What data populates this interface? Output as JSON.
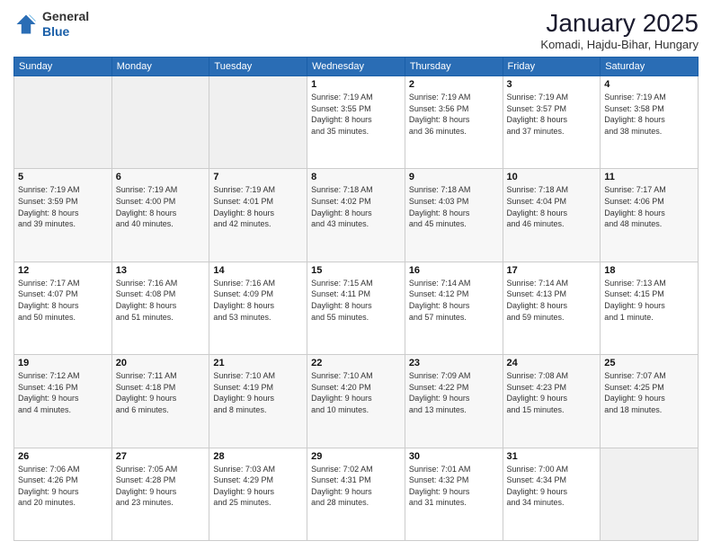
{
  "header": {
    "logo": {
      "general": "General",
      "blue": "Blue"
    },
    "title": "January 2025",
    "location": "Komadi, Hajdu-Bihar, Hungary"
  },
  "weekdays": [
    "Sunday",
    "Monday",
    "Tuesday",
    "Wednesday",
    "Thursday",
    "Friday",
    "Saturday"
  ],
  "weeks": [
    [
      {
        "day": "",
        "info": ""
      },
      {
        "day": "",
        "info": ""
      },
      {
        "day": "",
        "info": ""
      },
      {
        "day": "1",
        "info": "Sunrise: 7:19 AM\nSunset: 3:55 PM\nDaylight: 8 hours\nand 35 minutes."
      },
      {
        "day": "2",
        "info": "Sunrise: 7:19 AM\nSunset: 3:56 PM\nDaylight: 8 hours\nand 36 minutes."
      },
      {
        "day": "3",
        "info": "Sunrise: 7:19 AM\nSunset: 3:57 PM\nDaylight: 8 hours\nand 37 minutes."
      },
      {
        "day": "4",
        "info": "Sunrise: 7:19 AM\nSunset: 3:58 PM\nDaylight: 8 hours\nand 38 minutes."
      }
    ],
    [
      {
        "day": "5",
        "info": "Sunrise: 7:19 AM\nSunset: 3:59 PM\nDaylight: 8 hours\nand 39 minutes."
      },
      {
        "day": "6",
        "info": "Sunrise: 7:19 AM\nSunset: 4:00 PM\nDaylight: 8 hours\nand 40 minutes."
      },
      {
        "day": "7",
        "info": "Sunrise: 7:19 AM\nSunset: 4:01 PM\nDaylight: 8 hours\nand 42 minutes."
      },
      {
        "day": "8",
        "info": "Sunrise: 7:18 AM\nSunset: 4:02 PM\nDaylight: 8 hours\nand 43 minutes."
      },
      {
        "day": "9",
        "info": "Sunrise: 7:18 AM\nSunset: 4:03 PM\nDaylight: 8 hours\nand 45 minutes."
      },
      {
        "day": "10",
        "info": "Sunrise: 7:18 AM\nSunset: 4:04 PM\nDaylight: 8 hours\nand 46 minutes."
      },
      {
        "day": "11",
        "info": "Sunrise: 7:17 AM\nSunset: 4:06 PM\nDaylight: 8 hours\nand 48 minutes."
      }
    ],
    [
      {
        "day": "12",
        "info": "Sunrise: 7:17 AM\nSunset: 4:07 PM\nDaylight: 8 hours\nand 50 minutes."
      },
      {
        "day": "13",
        "info": "Sunrise: 7:16 AM\nSunset: 4:08 PM\nDaylight: 8 hours\nand 51 minutes."
      },
      {
        "day": "14",
        "info": "Sunrise: 7:16 AM\nSunset: 4:09 PM\nDaylight: 8 hours\nand 53 minutes."
      },
      {
        "day": "15",
        "info": "Sunrise: 7:15 AM\nSunset: 4:11 PM\nDaylight: 8 hours\nand 55 minutes."
      },
      {
        "day": "16",
        "info": "Sunrise: 7:14 AM\nSunset: 4:12 PM\nDaylight: 8 hours\nand 57 minutes."
      },
      {
        "day": "17",
        "info": "Sunrise: 7:14 AM\nSunset: 4:13 PM\nDaylight: 8 hours\nand 59 minutes."
      },
      {
        "day": "18",
        "info": "Sunrise: 7:13 AM\nSunset: 4:15 PM\nDaylight: 9 hours\nand 1 minute."
      }
    ],
    [
      {
        "day": "19",
        "info": "Sunrise: 7:12 AM\nSunset: 4:16 PM\nDaylight: 9 hours\nand 4 minutes."
      },
      {
        "day": "20",
        "info": "Sunrise: 7:11 AM\nSunset: 4:18 PM\nDaylight: 9 hours\nand 6 minutes."
      },
      {
        "day": "21",
        "info": "Sunrise: 7:10 AM\nSunset: 4:19 PM\nDaylight: 9 hours\nand 8 minutes."
      },
      {
        "day": "22",
        "info": "Sunrise: 7:10 AM\nSunset: 4:20 PM\nDaylight: 9 hours\nand 10 minutes."
      },
      {
        "day": "23",
        "info": "Sunrise: 7:09 AM\nSunset: 4:22 PM\nDaylight: 9 hours\nand 13 minutes."
      },
      {
        "day": "24",
        "info": "Sunrise: 7:08 AM\nSunset: 4:23 PM\nDaylight: 9 hours\nand 15 minutes."
      },
      {
        "day": "25",
        "info": "Sunrise: 7:07 AM\nSunset: 4:25 PM\nDaylight: 9 hours\nand 18 minutes."
      }
    ],
    [
      {
        "day": "26",
        "info": "Sunrise: 7:06 AM\nSunset: 4:26 PM\nDaylight: 9 hours\nand 20 minutes."
      },
      {
        "day": "27",
        "info": "Sunrise: 7:05 AM\nSunset: 4:28 PM\nDaylight: 9 hours\nand 23 minutes."
      },
      {
        "day": "28",
        "info": "Sunrise: 7:03 AM\nSunset: 4:29 PM\nDaylight: 9 hours\nand 25 minutes."
      },
      {
        "day": "29",
        "info": "Sunrise: 7:02 AM\nSunset: 4:31 PM\nDaylight: 9 hours\nand 28 minutes."
      },
      {
        "day": "30",
        "info": "Sunrise: 7:01 AM\nSunset: 4:32 PM\nDaylight: 9 hours\nand 31 minutes."
      },
      {
        "day": "31",
        "info": "Sunrise: 7:00 AM\nSunset: 4:34 PM\nDaylight: 9 hours\nand 34 minutes."
      },
      {
        "day": "",
        "info": ""
      }
    ]
  ]
}
